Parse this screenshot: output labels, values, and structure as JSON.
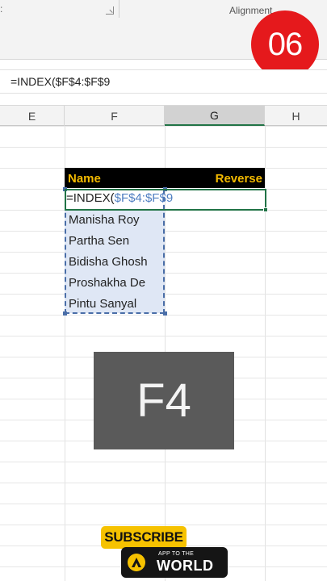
{
  "ribbon": {
    "edge_char": ":",
    "alignment_label": "Alignment"
  },
  "badge": {
    "step": "06"
  },
  "formula_bar": {
    "text": "=INDEX($F$4:$F$9"
  },
  "columns": [
    {
      "letter": "E",
      "active": false
    },
    {
      "letter": "F",
      "active": false
    },
    {
      "letter": "G",
      "active": true
    },
    {
      "letter": "H",
      "active": false
    }
  ],
  "table": {
    "header_name": "Name",
    "header_reverse": "Reverse",
    "edit_prefix": "=INDEX(",
    "edit_ref": "$F$4:$F$9",
    "names": [
      "Manisha Roy",
      "Partha Sen",
      "Bidisha Ghosh",
      "Proshakha De",
      "Pintu Sanyal"
    ]
  },
  "key_overlay": {
    "key": "F4"
  },
  "brand": {
    "subscribe": "SUBSCRIBE",
    "app_small": "APP TO THE",
    "app_big": "WORLD"
  },
  "colors": {
    "badge_red": "#e5191c",
    "header_gold": "#f2b900",
    "excel_green": "#217346",
    "range_blue": "#4a6ea8"
  }
}
